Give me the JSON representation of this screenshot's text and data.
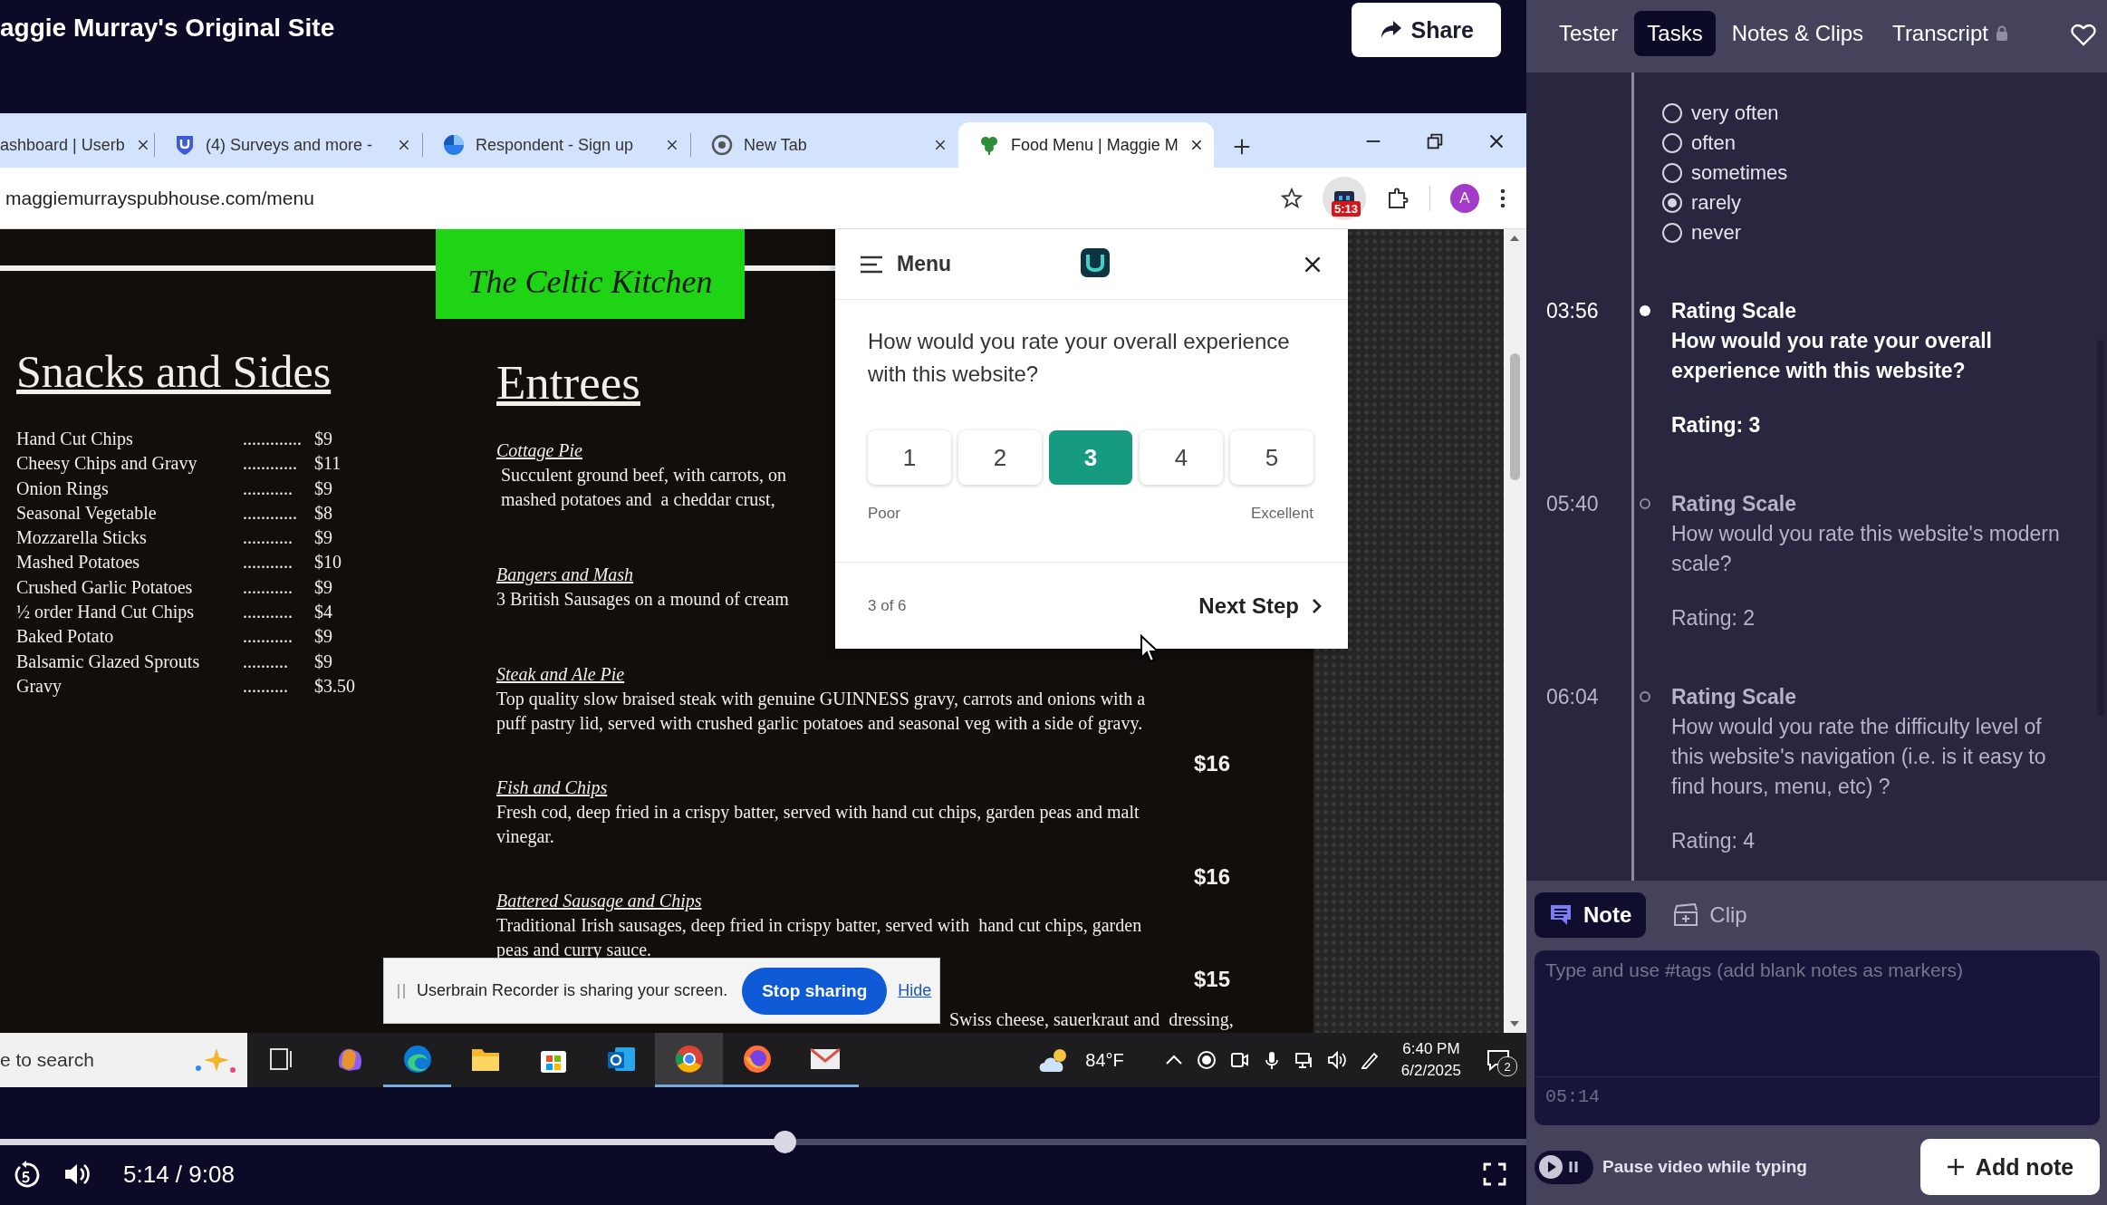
{
  "header": {
    "title": "aggie Murray's Original Site",
    "share_button": "Share"
  },
  "browser": {
    "tabs": [
      {
        "label": "ashboard | Userb",
        "kind": "none",
        "selected": false
      },
      {
        "label": "(4) Surveys and more -",
        "kind": "shield",
        "selected": false
      },
      {
        "label": "Respondent - Sign up",
        "kind": "pinwheel",
        "selected": false
      },
      {
        "label": "New Tab",
        "kind": "globe",
        "selected": false
      },
      {
        "label": "Food Menu | Maggie M",
        "kind": "clover",
        "selected": true
      }
    ],
    "url": "maggiemurrayspubhouse.com/menu",
    "extension_badge": "5:13",
    "avatar": "A"
  },
  "page": {
    "logo": "The Celtic Kitchen",
    "snacks": {
      "heading": "Snacks and Sides",
      "items": [
        {
          "name": "Hand Cut Chips",
          "leader": ".............",
          "price": "$9"
        },
        {
          "name": "Cheesy Chips and Gravy",
          "leader": "............",
          "price": "$11"
        },
        {
          "name": "Onion Rings",
          "leader": "...........",
          "price": "$9"
        },
        {
          "name": "Seasonal Vegetable",
          "leader": "............",
          "price": "$8"
        },
        {
          "name": "Mozzarella Sticks",
          "leader": "...........",
          "price": "$9"
        },
        {
          "name": "Mashed Potatoes",
          "leader": "...........",
          "price": "$10"
        },
        {
          "name": "Crushed Garlic Potatoes",
          "leader": "...........",
          "price": "$9"
        },
        {
          "name": "½ order Hand Cut Chips",
          "leader": "...........",
          "price": "$4"
        },
        {
          "name": "Baked Potato",
          "leader": "...........",
          "price": "$9"
        },
        {
          "name": "Balsamic Glazed Sprouts",
          "leader": "..........",
          "price": "$9"
        },
        {
          "name": "Gravy",
          "leader": "..........",
          "price": "$3.50"
        }
      ]
    },
    "entrees": {
      "heading": "Entrees",
      "items": [
        {
          "kind": "full",
          "name": "Cottage Pie",
          "lines": [
            "Succulent ground beef, with carrots, on",
            "mashed potatoes and  a cheddar crust,"
          ]
        },
        {
          "kind": "full",
          "name": "Bangers and Mash",
          "lines": [
            "3 British Sausages on a mound of cream"
          ]
        },
        {
          "kind": "full",
          "name": "Steak and Ale Pie",
          "lines": [
            "Top quality slow braised steak with genuine GUINNESS gravy, carrots and onions with a",
            "puff pastry lid, served with crushed garlic potatoes and seasonal veg with a side of gravy."
          ]
        },
        {
          "kind": "full",
          "price": "$16",
          "name": "Fish and Chips",
          "lines": [
            "Fresh cod, deep fried in a crispy batter, served with hand cut chips, garden peas and malt",
            "vinegar."
          ]
        },
        {
          "kind": "full",
          "price": "$16",
          "name": "Battered Sausage and Chips",
          "lines": [
            "Traditional Irish sausages, deep fried in crispy batter, served with  hand cut chips, garden",
            "peas and curry sauce."
          ]
        },
        {
          "kind": "covered",
          "price": "$15",
          "lines": [
            "Swiss cheese, sauerkraut and  dressing,"
          ]
        }
      ]
    }
  },
  "survey": {
    "menu_label": "Menu",
    "question": "How would you rate your overall experience with this website?",
    "options": [
      {
        "label": "1",
        "selected": false
      },
      {
        "label": "2",
        "selected": false
      },
      {
        "label": "3",
        "selected": true
      },
      {
        "label": "4",
        "selected": false
      },
      {
        "label": "5",
        "selected": false
      }
    ],
    "low_label": "Poor",
    "high_label": "Excellent",
    "progress": "3 of 6",
    "next_button": "Next Step"
  },
  "share_notice": {
    "message": "Userbrain Recorder is sharing your screen.",
    "stop_button": "Stop sharing",
    "hide_link": "Hide"
  },
  "taskbar": {
    "search_text": "e to search",
    "apps": [
      {
        "kind": "task-view",
        "running": false,
        "selected": false
      },
      {
        "kind": "copilot",
        "running": false,
        "selected": false
      },
      {
        "kind": "edge",
        "running": true,
        "selected": false
      },
      {
        "kind": "files",
        "running": false,
        "selected": false
      },
      {
        "kind": "store",
        "running": false,
        "selected": false
      },
      {
        "kind": "outlook",
        "running": false,
        "selected": false
      },
      {
        "kind": "chrome",
        "running": true,
        "selected": true
      },
      {
        "kind": "firefox",
        "running": true,
        "selected": false
      },
      {
        "kind": "envelope",
        "running": true,
        "selected": false
      }
    ],
    "weather": "84°F",
    "time": "6:40 PM",
    "date": "6/2/2025",
    "notifications": "2"
  },
  "player": {
    "level": 0.514,
    "time": "5:14 / 9:08"
  },
  "panel": {
    "tabs": [
      {
        "label": "Tester",
        "selected": false,
        "locked": false
      },
      {
        "label": "Tasks",
        "selected": true,
        "locked": false
      },
      {
        "label": "Notes & Clips",
        "selected": false,
        "locked": false
      },
      {
        "label": "Transcript",
        "selected": false,
        "locked": true
      }
    ],
    "options": [
      {
        "label": "very often",
        "selected": false
      },
      {
        "label": "often",
        "selected": false
      },
      {
        "label": "sometimes",
        "selected": false
      },
      {
        "label": "rarely",
        "selected": true
      },
      {
        "label": "never",
        "selected": false
      }
    ],
    "entries": [
      {
        "time": "03:56",
        "title": "Rating Scale",
        "question": "How would you rate your overall experience with this website?",
        "rating": "Rating: 3",
        "current": true
      },
      {
        "time": "05:40",
        "title": "Rating Scale",
        "question": "How would you rate this website's modern scale?",
        "rating": "Rating: 2",
        "current": false
      },
      {
        "time": "06:04",
        "title": "Rating Scale",
        "question": "How would you rate the difficulty level of this website's navigation (i.e. is it easy to find hours, menu, etc) ?",
        "rating": "Rating: 4",
        "current": false
      }
    ],
    "note_tabs": [
      {
        "label": "Note",
        "selected": true
      },
      {
        "label": "Clip",
        "selected": false
      }
    ],
    "note_placeholder": "Type and use #tags (add blank notes as markers)",
    "note_time": "05:14",
    "pause_on": false,
    "pause_label": "Pause video while typing",
    "add_button": "Add note"
  }
}
